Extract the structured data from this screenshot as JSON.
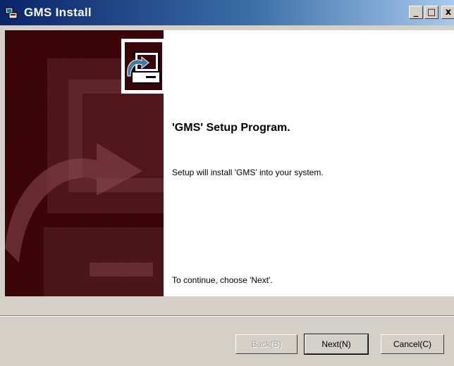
{
  "window": {
    "title": "GMS Install",
    "icon": "installer-icon",
    "controls": {
      "minimize": "_",
      "maximize": "□",
      "close": "x"
    }
  },
  "main": {
    "heading": "'GMS' Setup Program.",
    "description": "Setup will install 'GMS' into your system.",
    "continue_text": "To continue, choose 'Next'."
  },
  "buttons": {
    "back": "Back(B)",
    "next": "Next(N)",
    "cancel": "Cancel(C)"
  },
  "colors": {
    "accent": "#3b0508",
    "titlebar": "#0a246a"
  }
}
